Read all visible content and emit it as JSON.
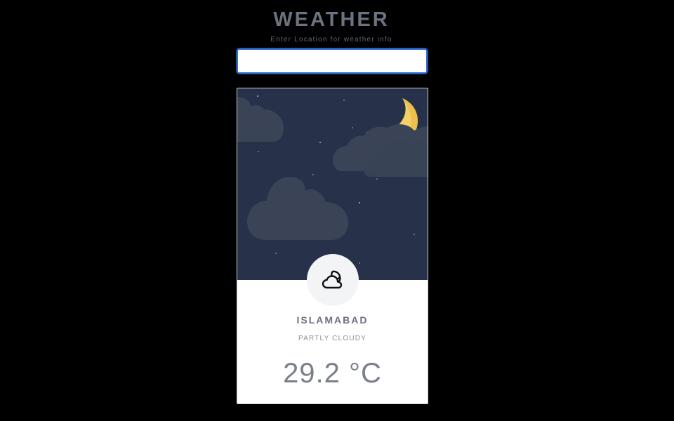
{
  "header": {
    "title": "WEATHER",
    "subtitle": "Enter Location for weather info"
  },
  "search": {
    "value": "",
    "placeholder": ""
  },
  "weather_card": {
    "city": "ISLAMABAD",
    "condition": "PARTLY CLOUDY",
    "temperature": "29.2 °C",
    "scene": "night-partly-cloudy",
    "icon": "cloud-moon-icon",
    "colors": {
      "sky": "#27314a",
      "moon": "#f5cf67",
      "cloud": "#3a4456",
      "card": "#ffffff"
    }
  }
}
